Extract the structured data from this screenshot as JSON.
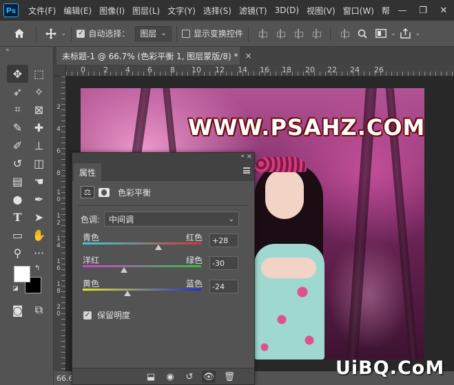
{
  "app": {
    "logo": "Ps"
  },
  "menu": [
    "文件(F)",
    "编辑(E)",
    "图像(I)",
    "图层(L)",
    "文字(Y)",
    "选择(S)",
    "滤镜(T)",
    "3D(D)",
    "视图(V)",
    "窗口(W)",
    "帮"
  ],
  "window_controls": {
    "minimize": "—",
    "restore": "❐",
    "close": "✕"
  },
  "options": {
    "auto_select_label": "自动选择：",
    "auto_select_checked": true,
    "auto_select_target": "图层",
    "show_transform_label": "显示变换控件",
    "show_transform_checked": false
  },
  "document": {
    "tab_title": "未标题-1 @ 66.7% (色彩平衡 1, 图层蒙版/8) *",
    "tab_close": "×",
    "zoom": "66.6",
    "ruler_top": [
      "0",
      "2",
      "4",
      "6",
      "8",
      "10",
      "12",
      "14",
      "16",
      "18",
      "20",
      "22",
      "24",
      "26"
    ],
    "ruler_left": [
      "2",
      "4",
      "6",
      "8",
      "1\n0",
      "1\n2",
      "1\n4",
      "1\n6",
      "1\n8",
      "2\n0"
    ],
    "image_text": "WWW.PSAHZ.COM"
  },
  "corner_watermark": "UiBQ.CoM",
  "properties_panel": {
    "tab_label": "属性",
    "collapse": "«",
    "close": "×",
    "adjustment_title": "色彩平衡",
    "tone_label": "色调:",
    "tone_value": "中间调",
    "sliders": [
      {
        "left": "青色",
        "right": "红色",
        "value": "+28",
        "position": 0.64,
        "gradient": [
          "#2fd0d8",
          "#d33"
        ]
      },
      {
        "left": "洋红",
        "right": "绿色",
        "value": "-30",
        "position": 0.35,
        "gradient": [
          "#d63fd6",
          "#2ec43a"
        ]
      },
      {
        "left": "黄色",
        "right": "蓝色",
        "value": "-24",
        "position": 0.38,
        "gradient": [
          "#e8e62a",
          "#1a2fd6"
        ]
      }
    ],
    "preserve_luminosity_label": "保留明度",
    "preserve_luminosity_checked": true
  },
  "icons": {
    "home": "home-icon",
    "move": "move-icon",
    "align": "align-icon",
    "search": "search-icon",
    "share": "share-icon",
    "visibility": "eye-icon",
    "trash": "trash-icon"
  }
}
